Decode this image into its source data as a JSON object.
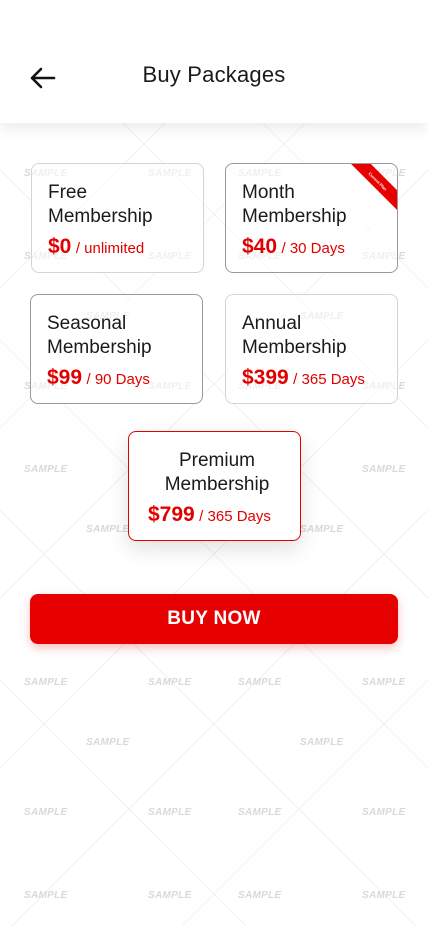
{
  "header": {
    "title": "Buy Packages",
    "back_icon": "arrow-left-icon"
  },
  "packages": [
    {
      "title": "Free\nMembership",
      "price": "$0",
      "period": "/ unlimited",
      "selected": false
    },
    {
      "title": "Month\nMembership",
      "price": "$40",
      "period": "/ 30 Days",
      "selected": false,
      "ribbon": "Current Plan"
    },
    {
      "title": "Seasonal\nMembership",
      "price": "$99",
      "period": "/ 90 Days",
      "selected": false
    },
    {
      "title": "Annual\nMembership",
      "price": "$399",
      "period": "/ 365 Days",
      "selected": false
    },
    {
      "title": "Premium\nMembership",
      "price": "$799",
      "period": "/ 365 Days",
      "selected": true
    }
  ],
  "buy_button": {
    "label": "BUY NOW"
  },
  "watermark": {
    "text": "SAMPLE"
  },
  "colors": {
    "accent": "#e60000",
    "text": "#1a1a1a",
    "watermark": "#d9d9d9"
  }
}
